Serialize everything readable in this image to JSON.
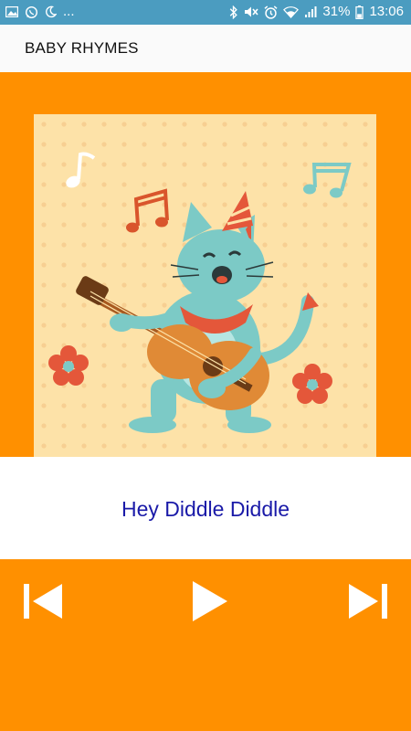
{
  "status_bar": {
    "more_indicator": "...",
    "battery_percent": "31%",
    "time": "13:06",
    "icons": [
      "image-icon",
      "whatsapp-icon",
      "moon-icon",
      "bluetooth-icon",
      "mute-icon",
      "alarm-icon",
      "wifi-icon",
      "signal-icon",
      "battery-icon"
    ]
  },
  "app_bar": {
    "title": "BABY RHYMES"
  },
  "artwork": {
    "subject": "cat-playing-guitar-illustration"
  },
  "now_playing": {
    "song_title": "Hey Diddle Diddle"
  },
  "controls": {
    "icons": [
      "skip-previous-icon",
      "play-icon",
      "skip-next-icon"
    ],
    "color": "#ffffff"
  },
  "colors": {
    "status_bar": "#4b9cc0",
    "app_bar": "#fafafa",
    "accent": "#ff9000",
    "song_title": "#1a1aa8",
    "artwork_bg": "#fde2a8"
  }
}
